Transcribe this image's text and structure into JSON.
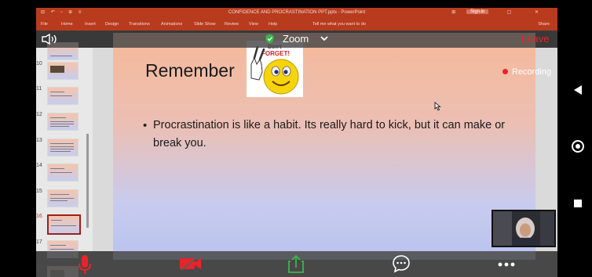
{
  "powerpoint": {
    "quick_access": "⊟ ↶ ▫ ⊕ ≡",
    "doc_title": "CONFIDENCE AND PROCRASTINATION PPT.pptx - PowerPoint",
    "sign_in": "Sign in",
    "window_controls": "⊞ — ▢ ✕",
    "tabs": [
      "File",
      "Home",
      "Insert",
      "Design",
      "Transitions",
      "Animations",
      "Slide Show",
      "Review",
      "View",
      "Help",
      "Tell me what you want to do"
    ],
    "share": "Share"
  },
  "zoom": {
    "title": "Zoom",
    "leave_label": "Leave",
    "recording_label": "Recording",
    "secure_color": "#3ab54a",
    "leave_color": "#e8242b"
  },
  "thumbnails": [
    {
      "number": ""
    },
    {
      "number": "10"
    },
    {
      "number": "11"
    },
    {
      "number": "12"
    },
    {
      "number": "13"
    },
    {
      "number": "14"
    },
    {
      "number": "15"
    },
    {
      "number": "16",
      "active": true
    },
    {
      "number": "17"
    },
    {
      "number": "18"
    }
  ],
  "slide": {
    "title": "Remember",
    "image_text": "Don't FORGET!",
    "bullet": "Procrastination is like a habit. Its really hard to kick, but it can make or break you."
  },
  "toolbar_icons": [
    "mic-muted-icon",
    "video-off-icon",
    "share-screen-icon",
    "chat-icon",
    "more-icon"
  ],
  "android_nav": [
    "back-icon",
    "home-icon",
    "recent-apps-icon"
  ]
}
